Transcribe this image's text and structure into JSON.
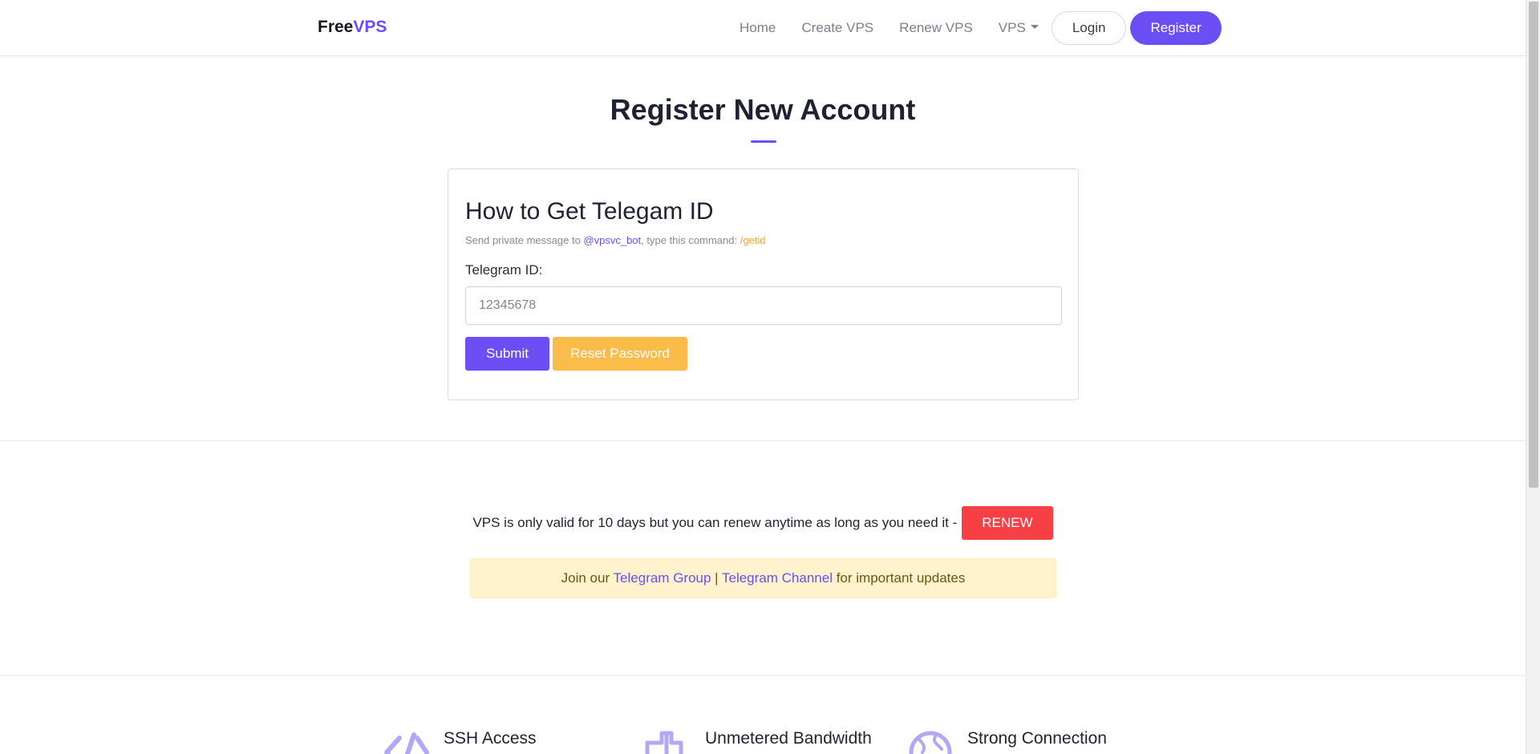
{
  "navbar": {
    "brand_prefix": "Free",
    "brand_accent": "VPS",
    "links": [
      {
        "label": "Home"
      },
      {
        "label": "Create VPS"
      },
      {
        "label": "Renew VPS"
      },
      {
        "label": "VPS"
      }
    ],
    "login_label": "Login",
    "register_label": "Register"
  },
  "page": {
    "title": "Register New Account"
  },
  "card": {
    "title": "How to Get Telegam ID",
    "help_prefix": "Send private message to ",
    "help_bot": "@vpsvc_bot",
    "help_middle": ", type this command: ",
    "help_command": "/getid",
    "field_label": "Telegram ID:",
    "input_placeholder": "12345678",
    "input_value": "",
    "submit_label": "Submit",
    "reset_label": "Reset Password"
  },
  "notice": {
    "text": "VPS is only valid for 10 days but you can renew anytime as long as you need it -",
    "renew_label": "RENEW",
    "telegram_prefix": "Join our ",
    "telegram_group": "Telegram Group",
    "telegram_sep": " | ",
    "telegram_channel": "Telegram Channel",
    "telegram_suffix": " for important updates"
  },
  "features": [
    {
      "title": "SSH Access",
      "icon": "code-icon"
    },
    {
      "title": "Unmetered Bandwidth",
      "icon": "plus-icon"
    },
    {
      "title": "Strong Connection",
      "icon": "globe-icon"
    }
  ],
  "colors": {
    "accent": "#6c4ef5",
    "warning": "#fbbc4a",
    "danger": "#f64046",
    "notice_bg": "#fef3cd"
  }
}
